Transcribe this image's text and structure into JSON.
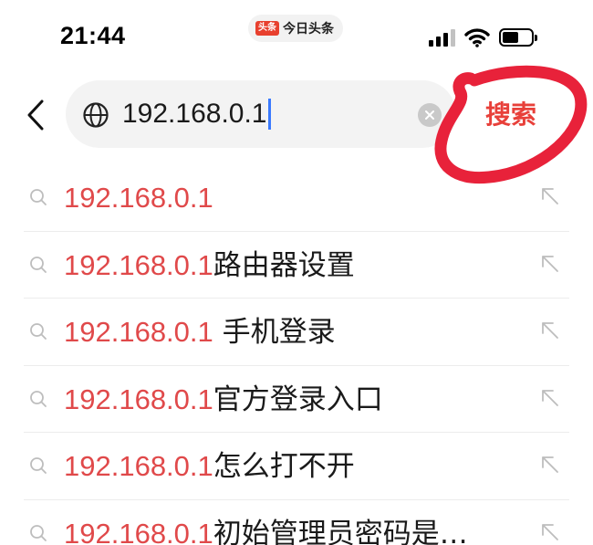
{
  "status_bar": {
    "time": "21:44",
    "app_badge_logo": "头条",
    "app_badge_text": "今日头条"
  },
  "search": {
    "query": "192.168.0.1",
    "button_label": "搜索"
  },
  "colors": {
    "highlight": "#e0494a",
    "annotation_circle": "#e8223a"
  },
  "suggestions": [
    {
      "highlight": "192.168.0.1",
      "rest": ""
    },
    {
      "highlight": "192.168.0.1",
      "rest": "路由器设置"
    },
    {
      "highlight": "192.168.0.1",
      "rest": " 手机登录"
    },
    {
      "highlight": "192.168.0.1",
      "rest": "官方登录入口"
    },
    {
      "highlight": "192.168.0.1",
      "rest": "怎么打不开"
    },
    {
      "highlight": "192.168.0.1",
      "rest": "初始管理员密码是…"
    }
  ]
}
